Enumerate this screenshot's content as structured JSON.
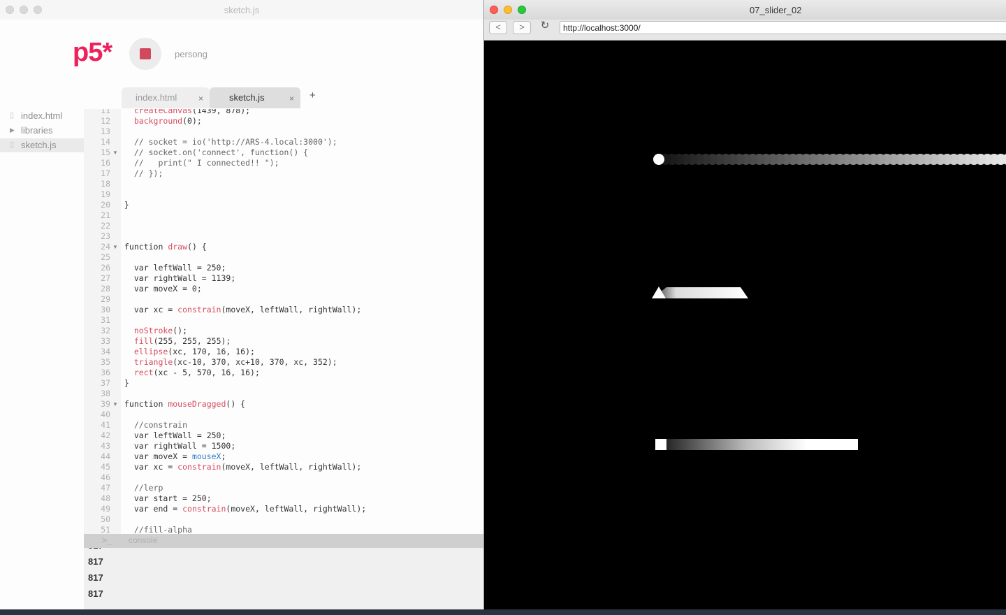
{
  "editor": {
    "window_title": "sketch.js",
    "logo": "p5*",
    "sketch_name": "persong",
    "tabs": [
      {
        "label": "index.html",
        "close": "×"
      },
      {
        "label": "sketch.js",
        "close": "×"
      }
    ],
    "add_tab": "+",
    "files": [
      {
        "label": "index.html",
        "icon": "file-icon"
      },
      {
        "label": "libraries",
        "icon": "folder-triangle-icon"
      },
      {
        "label": "sketch.js",
        "icon": "file-icon"
      }
    ],
    "code_lines": [
      {
        "n": "11",
        "text": "  createCanvas(1439, 878);"
      },
      {
        "n": "12",
        "text": "  background(0);"
      },
      {
        "n": "13",
        "text": ""
      },
      {
        "n": "14",
        "text": "  // socket = io('http://ARS-4.local:3000');"
      },
      {
        "n": "15",
        "text": "  // socket.on('connect', function() {",
        "fold": true
      },
      {
        "n": "16",
        "text": "  //   print(\" I connected!! \");"
      },
      {
        "n": "17",
        "text": "  // });"
      },
      {
        "n": "18",
        "text": ""
      },
      {
        "n": "19",
        "text": ""
      },
      {
        "n": "20",
        "text": "}"
      },
      {
        "n": "21",
        "text": ""
      },
      {
        "n": "22",
        "text": ""
      },
      {
        "n": "23",
        "text": ""
      },
      {
        "n": "24",
        "text": "function draw() {",
        "fold": true
      },
      {
        "n": "25",
        "text": ""
      },
      {
        "n": "26",
        "text": "  var leftWall = 250;"
      },
      {
        "n": "27",
        "text": "  var rightWall = 1139;"
      },
      {
        "n": "28",
        "text": "  var moveX = 0;"
      },
      {
        "n": "29",
        "text": ""
      },
      {
        "n": "30",
        "text": "  var xc = constrain(moveX, leftWall, rightWall);"
      },
      {
        "n": "31",
        "text": ""
      },
      {
        "n": "32",
        "text": "  noStroke();"
      },
      {
        "n": "33",
        "text": "  fill(255, 255, 255);"
      },
      {
        "n": "34",
        "text": "  ellipse(xc, 170, 16, 16);"
      },
      {
        "n": "35",
        "text": "  triangle(xc-10, 370, xc+10, 370, xc, 352);"
      },
      {
        "n": "36",
        "text": "  rect(xc - 5, 570, 16, 16);"
      },
      {
        "n": "37",
        "text": "}"
      },
      {
        "n": "38",
        "text": ""
      },
      {
        "n": "39",
        "text": "function mouseDragged() {",
        "fold": true
      },
      {
        "n": "40",
        "text": ""
      },
      {
        "n": "41",
        "text": "  //constrain"
      },
      {
        "n": "42",
        "text": "  var leftWall = 250;"
      },
      {
        "n": "43",
        "text": "  var rightWall = 1500;"
      },
      {
        "n": "44",
        "text": "  var moveX = mouseX;"
      },
      {
        "n": "45",
        "text": "  var xc = constrain(moveX, leftWall, rightWall);"
      },
      {
        "n": "46",
        "text": ""
      },
      {
        "n": "47",
        "text": "  //lerp"
      },
      {
        "n": "48",
        "text": "  var start = 250;"
      },
      {
        "n": "49",
        "text": "  var end = constrain(moveX, leftWall, rightWall);"
      },
      {
        "n": "50",
        "text": ""
      },
      {
        "n": "51",
        "text": "  //fill-alpha"
      }
    ],
    "console": {
      "prompt": ">_",
      "label": "console",
      "logs": [
        "817",
        "817",
        "817",
        "817"
      ]
    }
  },
  "browser": {
    "window_title": "07_slider_02",
    "back": "<",
    "forward": ">",
    "reload": "↻",
    "url": "http://localhost:3000/"
  }
}
